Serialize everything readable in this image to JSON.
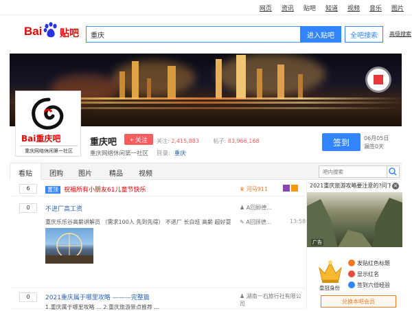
{
  "topnav": {
    "links": [
      "网页",
      "资讯",
      "贴吧",
      "知道",
      "视频",
      "音乐",
      "图片"
    ]
  },
  "logo": {
    "bai": "Bai",
    "tieba": "贴吧"
  },
  "search": {
    "value": "重庆",
    "enter_label": "进入贴吧",
    "all_label": "全吧搜索",
    "advanced": "高级搜索"
  },
  "forum": {
    "name": "重庆吧",
    "follow_label": "+ 关注",
    "followers_label": "关注:",
    "followers": "2,415,883",
    "posts_label": "帖子:",
    "posts": "83,966,168",
    "description": "重庆网络休闲第一社区",
    "category_label": "目录:",
    "category": "重庆",
    "signin_label": "签到",
    "date_line1": "06月05日",
    "date_line2": "漏签0天",
    "avatar_brand": "Bai重庆吧",
    "avatar_sub": "重庆网络休闲第一社区"
  },
  "tabs": [
    "看贴",
    "团购",
    "图片",
    "精品",
    "视频"
  ],
  "intra_search_placeholder": "吧内搜索",
  "posts": [
    {
      "count": "6",
      "tag": "置顶",
      "title": "祝福所有小朋友61儿童节快乐",
      "author": "河马911"
    },
    {
      "count": "0",
      "title": "不进厂高工资",
      "author": "A回顾德...",
      "excerpt": "重庆乐乐谷高薪讲解员 （需求100人 先到先得） 不进厂 长白班 高薪 超好耍 ...",
      "last_reply": "A回顾德...",
      "time": "13:58"
    },
    {
      "count": "0",
      "title": "2021重庆属于哪里攻略 ———完整篇",
      "author": "湖南一石旅行社有限公司",
      "excerpt": "1.重庆属于哪里攻略 ... 2.重庆旅游景点推荐 ..."
    }
  ],
  "side_ad": {
    "title": "2021重庆旅游攻略要注意的?问下",
    "close": "×",
    "ad_label": "广告",
    "vip_label": "皇冠身份",
    "perks": [
      "发贴红色标题",
      "显示红名",
      "签到六倍经验"
    ],
    "open_vip": "兑换本吧会员"
  }
}
